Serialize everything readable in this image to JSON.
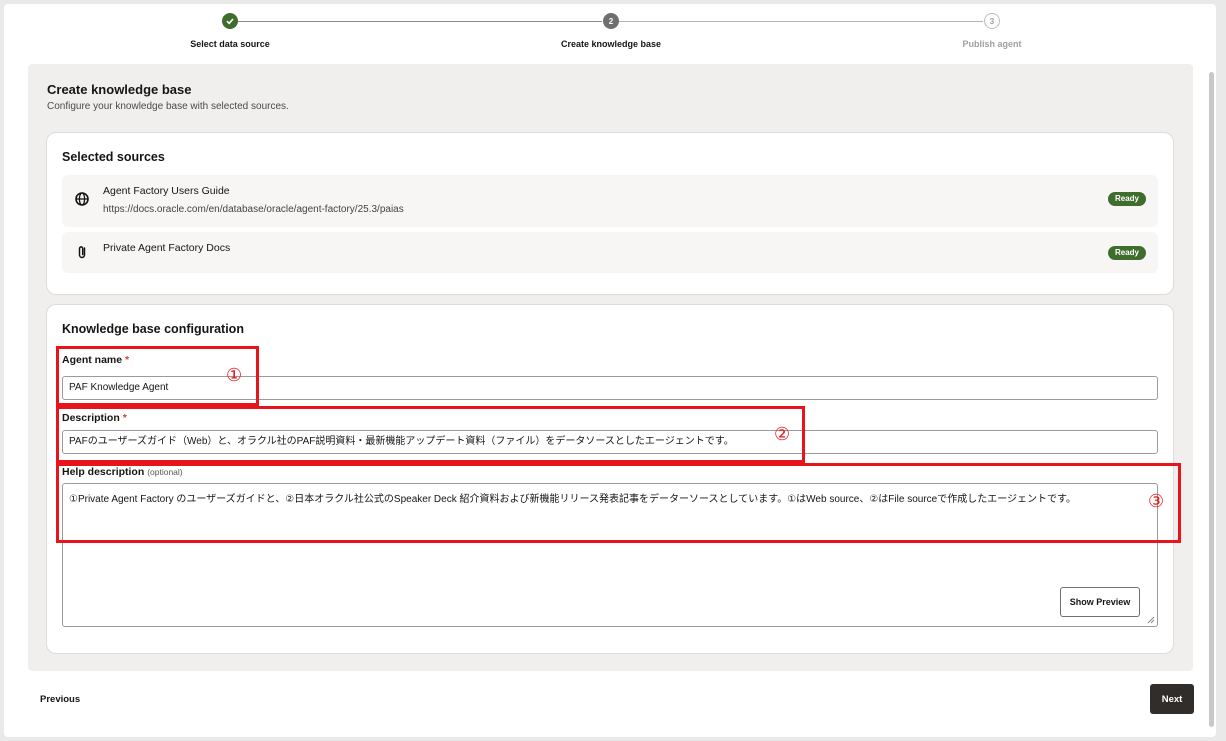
{
  "stepper": {
    "steps": [
      {
        "number": "",
        "label": "Select data source",
        "state": "done"
      },
      {
        "number": "2",
        "label": "Create knowledge base",
        "state": "current"
      },
      {
        "number": "3",
        "label": "Publish agent",
        "state": "future"
      }
    ]
  },
  "page": {
    "title": "Create knowledge base",
    "subtitle": "Configure your knowledge base with selected sources."
  },
  "sources": {
    "title": "Selected sources",
    "items": [
      {
        "name": "Agent Factory Users Guide",
        "url": "https://docs.oracle.com/en/database/oracle/agent-factory/25.3/paias",
        "status": "Ready",
        "icon": "globe-icon"
      },
      {
        "name": "Private Agent Factory Docs",
        "url": "",
        "status": "Ready",
        "icon": "paperclip-icon"
      }
    ]
  },
  "config": {
    "title": "Knowledge base configuration",
    "agent_name": {
      "label": "Agent name",
      "required": "*",
      "value": "PAF Knowledge Agent"
    },
    "description": {
      "label": "Description",
      "required": "*",
      "value": "PAFのユーザーズガイド（Web）と、オラクル社のPAF説明資料・最新機能アップデート資料（ファイル）をデータソースとしたエージェントです。"
    },
    "help_description": {
      "label": "Help description",
      "optional": "(optional)",
      "value": "①Private Agent Factory のユーザーズガイドと、②日本オラクル社公式のSpeaker Deck 紹介資料および新機能リリース発表記事をデーターソースとしています。①はWeb source、②はFile sourceで作成したエージェントです。"
    },
    "preview_button": "Show Preview"
  },
  "annotations": [
    "①",
    "②",
    "③"
  ],
  "footer": {
    "previous": "Previous",
    "next": "Next"
  },
  "colors": {
    "accent_green": "#3f6d2e",
    "annotation_red": "#e8141b",
    "next_button": "#312d2a"
  }
}
